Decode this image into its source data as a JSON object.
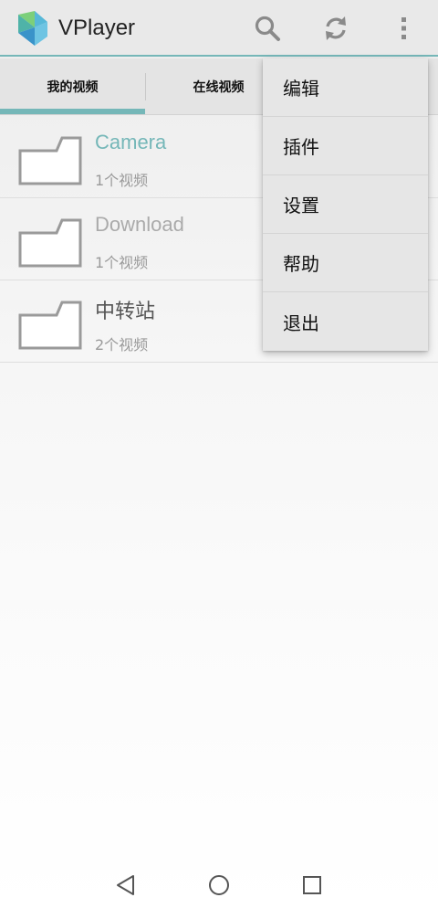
{
  "app": {
    "title": "VPlayer",
    "accent_color": "#75b7b8"
  },
  "toolbar": {
    "icons": [
      "search-icon",
      "refresh-icon",
      "more-vert-icon"
    ]
  },
  "tabs": [
    {
      "label": "我的视频",
      "selected": true
    },
    {
      "label": "在线视频",
      "selected": false
    }
  ],
  "folders": [
    {
      "name": "Camera",
      "count": "1个视频",
      "state": "active"
    },
    {
      "name": "Download",
      "count": "1个视频",
      "state": "dim"
    },
    {
      "name": "中转站",
      "count": "2个视频",
      "state": "normal"
    }
  ],
  "menu": {
    "items": [
      {
        "label": "编辑"
      },
      {
        "label": "插件"
      },
      {
        "label": "设置"
      },
      {
        "label": "帮助"
      },
      {
        "label": "退出"
      }
    ]
  },
  "navbar": {
    "icons": [
      "back-icon",
      "home-icon",
      "recents-icon"
    ]
  }
}
